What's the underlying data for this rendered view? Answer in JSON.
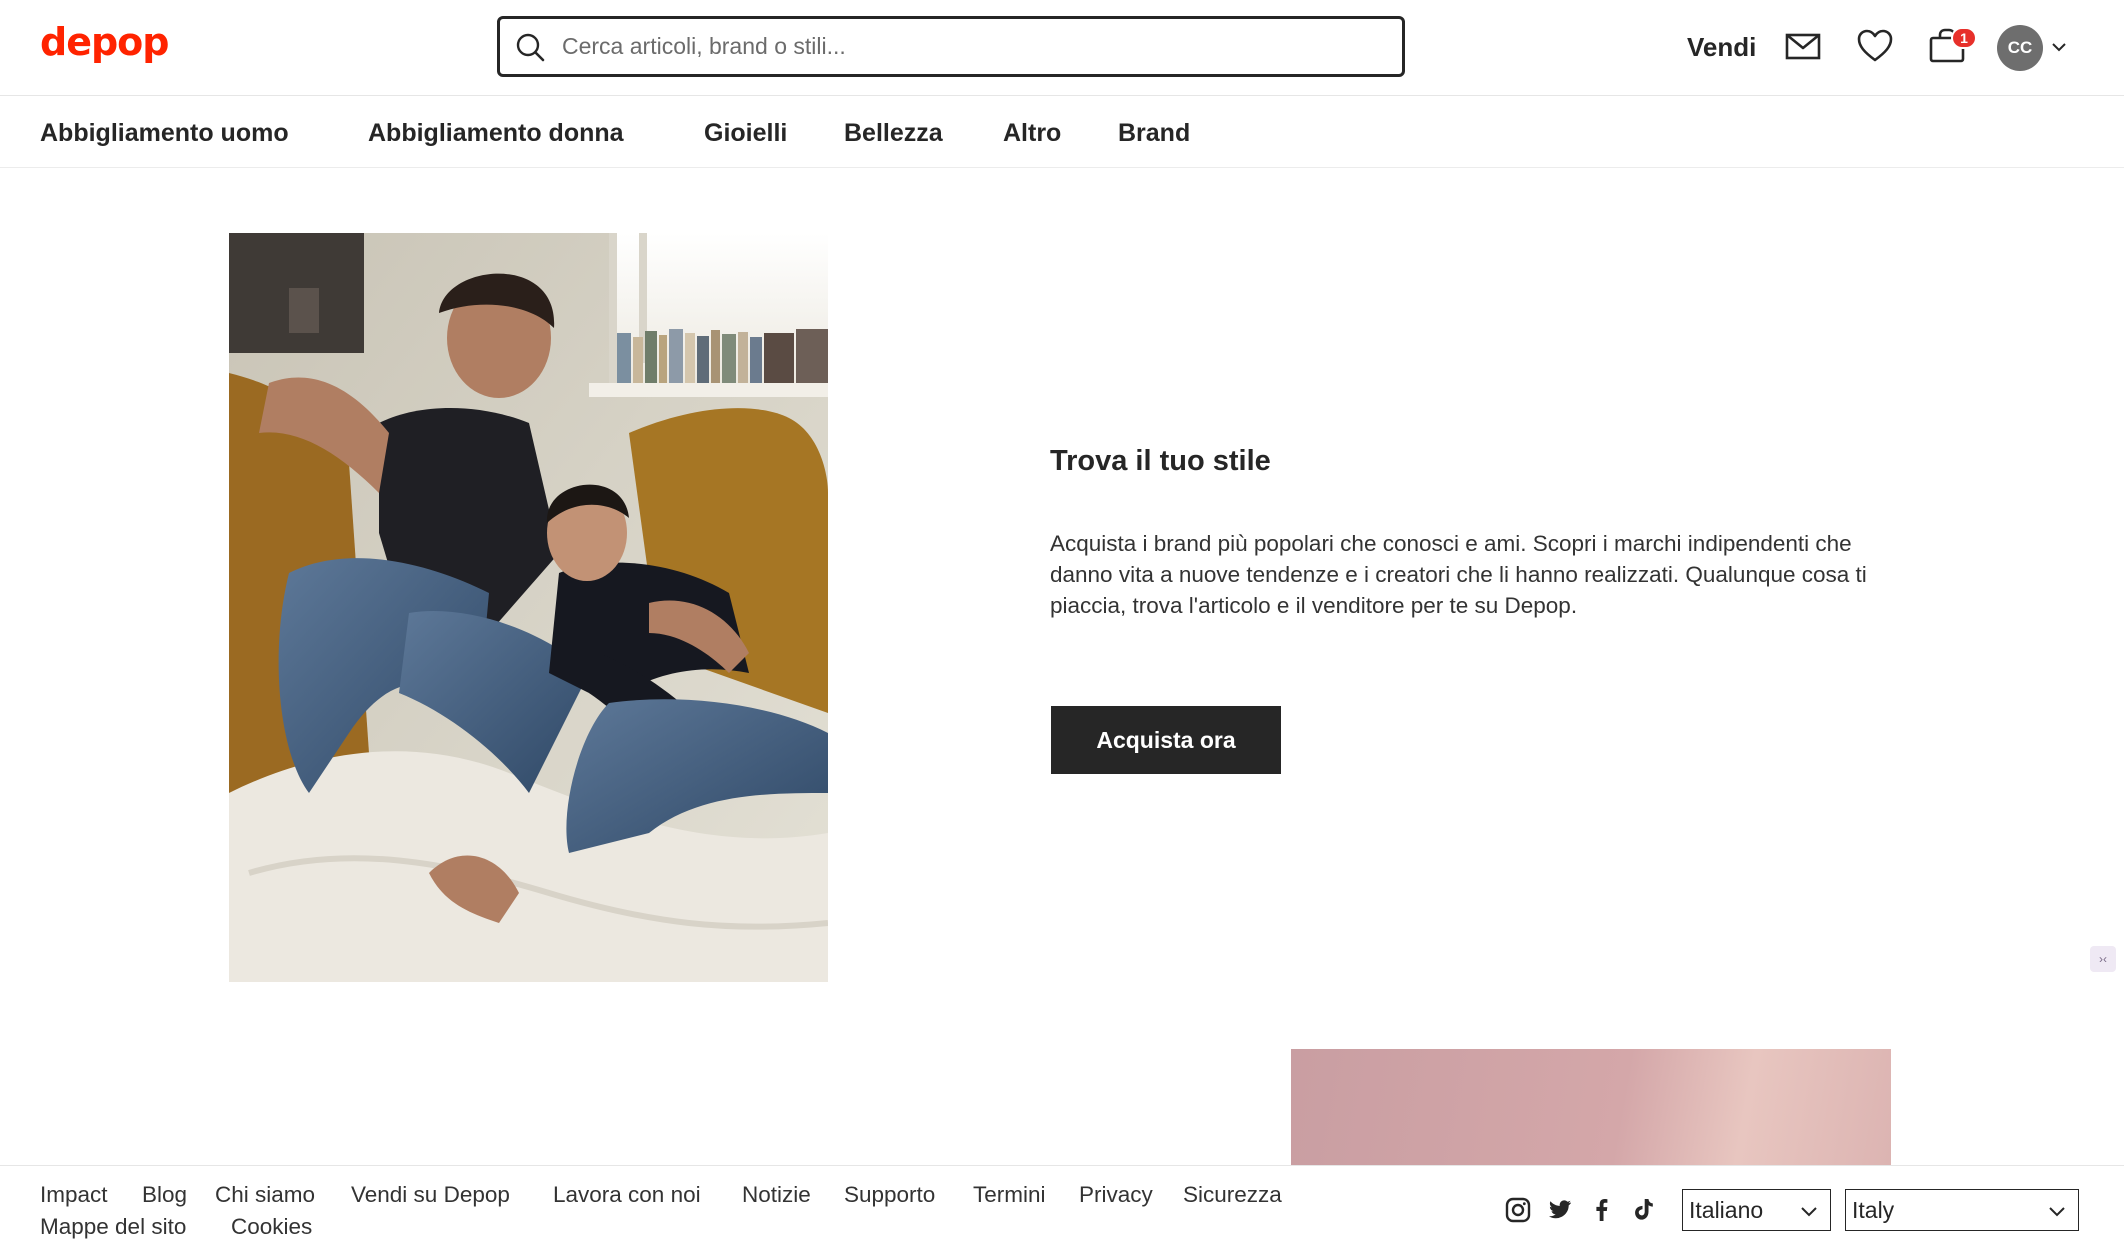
{
  "header": {
    "logo": "depop",
    "search_placeholder": "Cerca articoli, brand o stili...",
    "sell_label": "Vendi",
    "cart_count": "1",
    "avatar_initials": "CC"
  },
  "categories": [
    "Abbigliamento uomo",
    "Abbigliamento donna",
    "Gioielli",
    "Bellezza",
    "Altro",
    "Brand"
  ],
  "hero": {
    "title": "Trova il tuo stile",
    "description": "Acquista i brand più popolari che conosci e ami. Scopri i marchi indipendenti che danno vita a nuove tendenze e i creatori che li hanno realizzati. Qualunque cosa ti piaccia, trova l'articolo e il venditore per te su Depop.",
    "button_label": "Acquista ora"
  },
  "footer": {
    "links_row1": [
      "Impact",
      "Blog",
      "Chi siamo",
      "Vendi su Depop",
      "Lavora con noi",
      "Notizie",
      "Supporto",
      "Termini",
      "Privacy",
      "Sicurezza"
    ],
    "links_row2": [
      "Mappe del sito",
      "Cookies"
    ],
    "social_icons": [
      "instagram-icon",
      "twitter-icon",
      "facebook-icon",
      "tiktok-icon"
    ],
    "language": "Italiano",
    "country": "Italy"
  },
  "colors": {
    "brand": "#ff2300",
    "dark": "#262626",
    "badge": "#e7302a"
  }
}
